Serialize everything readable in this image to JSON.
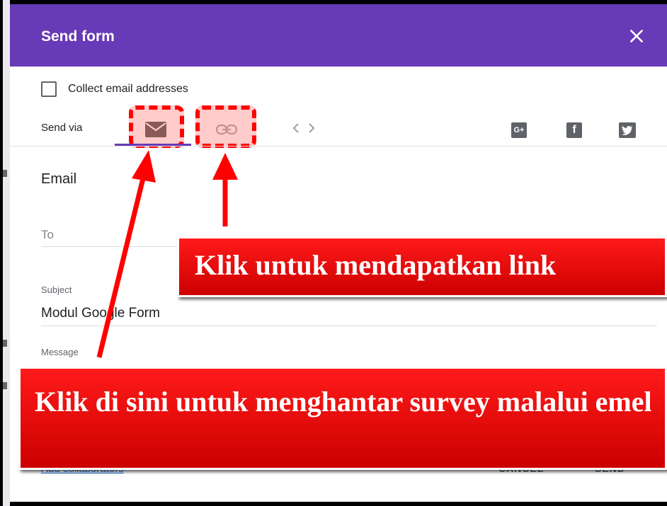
{
  "dialog": {
    "title": "Send form",
    "close_icon": "close-icon"
  },
  "options": {
    "collect_email_label": "Collect email addresses",
    "collect_email_checked": false
  },
  "send_via": {
    "label": "Send via",
    "tabs": [
      {
        "name": "email",
        "icon": "mail-icon",
        "selected": true
      },
      {
        "name": "link",
        "icon": "link-icon",
        "selected": false
      },
      {
        "name": "embed",
        "icon": "embed-code-icon",
        "selected": false
      }
    ],
    "social": [
      {
        "name": "google-plus",
        "glyph": "G+"
      },
      {
        "name": "facebook",
        "glyph": "f"
      },
      {
        "name": "twitter",
        "glyph": "t"
      }
    ]
  },
  "email_panel": {
    "title": "Email",
    "to_placeholder": "To",
    "subject_label": "Subject",
    "subject_value": "Modul Google Form",
    "message_label": "Message"
  },
  "footer": {
    "add_collaborators": "Add collaborators",
    "cancel": "CANCEL",
    "send": "SEND"
  },
  "annotations": {
    "callout_link": "Klik untuk mendapatkan link",
    "callout_email": "Klik di sini untuk menghantar survey malalui emel",
    "highlight_color": "#ff0000"
  },
  "colors": {
    "header": "#673ab7",
    "accent": "#673ab7"
  }
}
